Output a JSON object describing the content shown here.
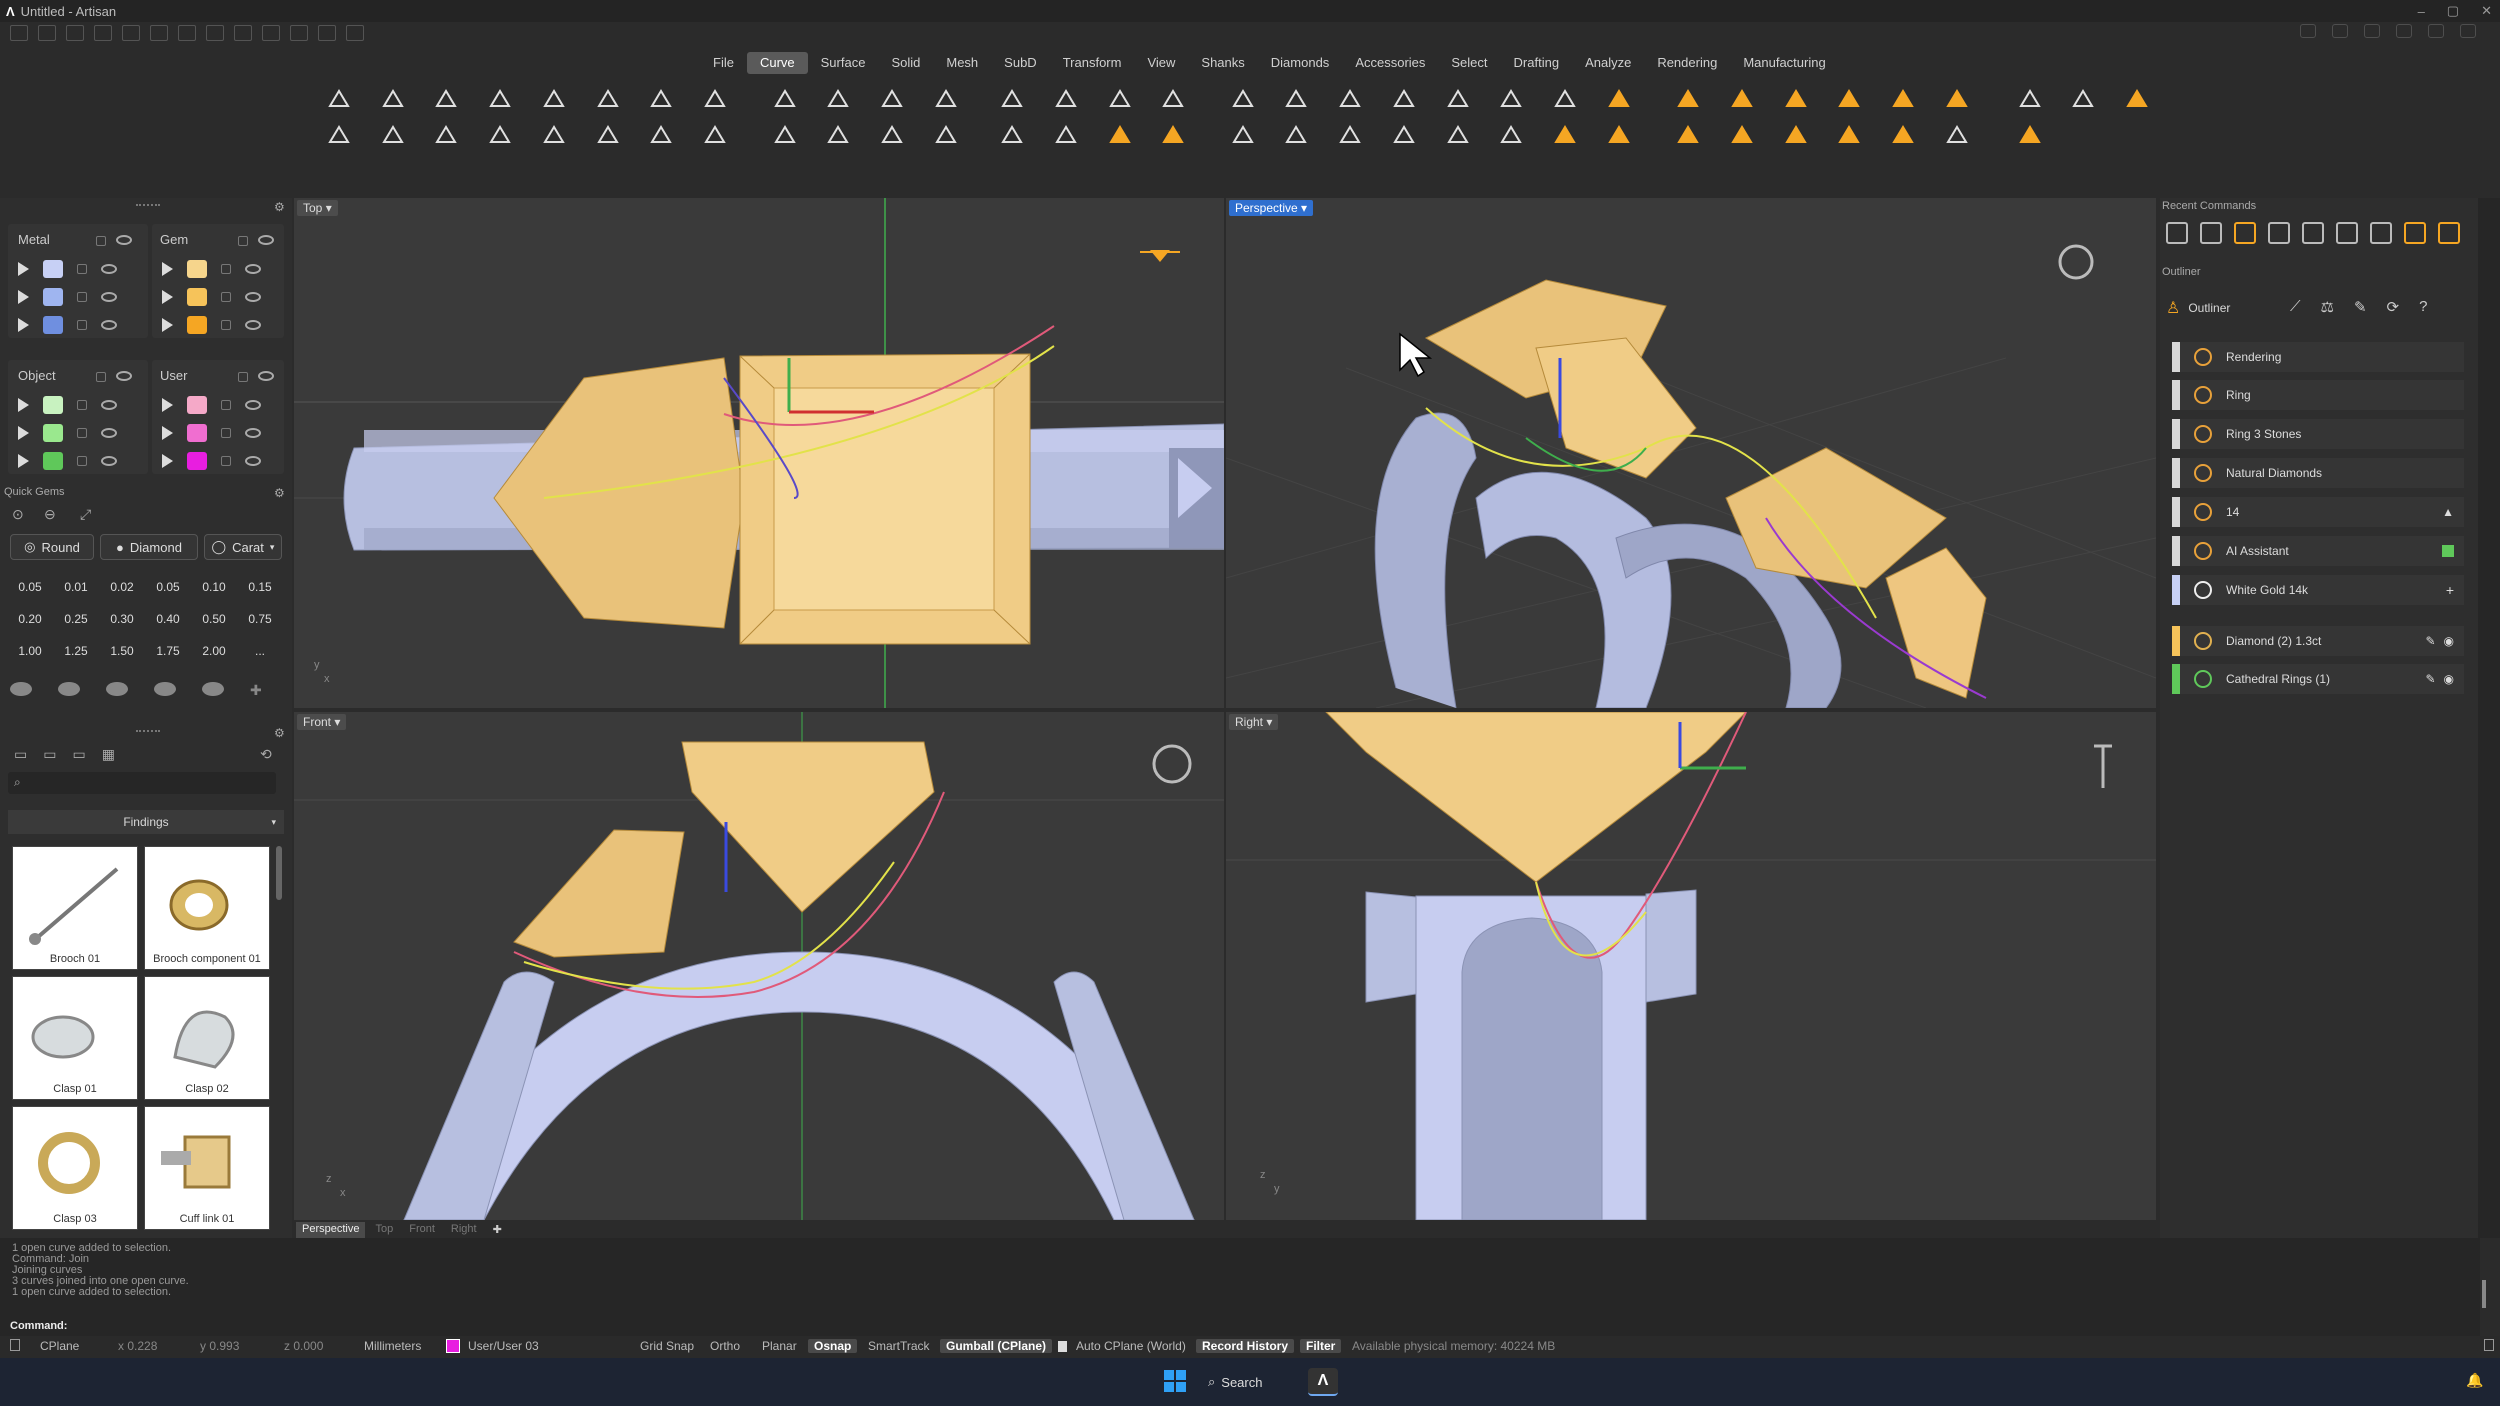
{
  "window": {
    "title": "Untitled - Artisan",
    "min": "–",
    "max": "▢",
    "close": "✕"
  },
  "menu": [
    "File",
    "Curve",
    "Surface",
    "Solid",
    "Mesh",
    "SubD",
    "Transform",
    "View",
    "Shanks",
    "Diamonds",
    "Accessories",
    "Select",
    "Drafting",
    "Analyze",
    "Rendering",
    "Manufacturing"
  ],
  "menu_active": "Curve",
  "layers": {
    "metal": "Metal",
    "gem": "Gem",
    "object": "Object",
    "user": "User",
    "metal_colors": [
      "#c7d0f5",
      "#9fb5f0",
      "#6f8fe0"
    ],
    "gem_colors": [
      "#f6d58c",
      "#f6c35a",
      "#f5a623"
    ],
    "object_colors": [
      "#c8f2c0",
      "#9ae88e",
      "#5fc85a"
    ],
    "user_colors": [
      "#f5a9c8",
      "#f06ed0",
      "#e81ee0"
    ]
  },
  "quick_gems": {
    "title": "Quick Gems",
    "shape": "Round",
    "material": "Diamond",
    "unit": "Carat",
    "sizes": [
      "0.05",
      "0.01",
      "0.02",
      "0.05",
      "0.10",
      "0.15",
      "0.20",
      "0.25",
      "0.30",
      "0.40",
      "0.50",
      "0.75",
      "1.00",
      "1.25",
      "1.50",
      "1.75",
      "2.00",
      "..."
    ]
  },
  "library": {
    "category": "Findings",
    "items": [
      "Brooch 01",
      "Brooch component 01",
      "Clasp 01",
      "Clasp 02",
      "Clasp 03",
      "Cuff link 01"
    ]
  },
  "viewports": {
    "top": "Top",
    "perspective": "Perspective",
    "front": "Front",
    "right": "Right"
  },
  "viewport_tabs": [
    "Perspective",
    "Top",
    "Front",
    "Right"
  ],
  "recent_commands_title": "Recent Commands",
  "outliner": {
    "title": "Outliner",
    "tab": "Outliner",
    "items": [
      {
        "label": "Rendering",
        "color": "#d8d8d8"
      },
      {
        "label": "Ring",
        "color": "#d8d8d8"
      },
      {
        "label": "Ring 3 Stones",
        "color": "#d8d8d8"
      },
      {
        "label": "Natural Diamonds",
        "color": "#d8d8d8"
      },
      {
        "label": "14",
        "color": "#d8d8d8"
      },
      {
        "label": "AI Assistant",
        "color": "#d8d8d8"
      },
      {
        "label": "White Gold 14k",
        "color": "#c7d0f5"
      },
      {
        "label": "Diamond (2) 1.3ct",
        "color": "#f6c35a"
      },
      {
        "label": "Cathedral Rings (1)",
        "color": "#5fc85a"
      }
    ]
  },
  "command_history": [
    "1 open curve added to selection.",
    "Command: Join",
    "Joining curves",
    "3 curves joined into one open curve.",
    "1 open curve added to selection."
  ],
  "command_prompt": "Command:",
  "status": {
    "cplane": "CPlane",
    "x": "x 0.228",
    "y": "y 0.993",
    "z": "z 0.000",
    "units": "Millimeters",
    "layer": "User/User 03",
    "grid_snap": "Grid Snap",
    "ortho": "Ortho",
    "planar": "Planar",
    "osnap": "Osnap",
    "smarttrack": "SmartTrack",
    "gumball": "Gumball (CPlane)",
    "auto_cplane": "Auto CPlane (World)",
    "record_history": "Record History",
    "filter": "Filter",
    "memory": "Available physical memory: 40224 MB"
  },
  "taskbar": {
    "search": "Search"
  }
}
